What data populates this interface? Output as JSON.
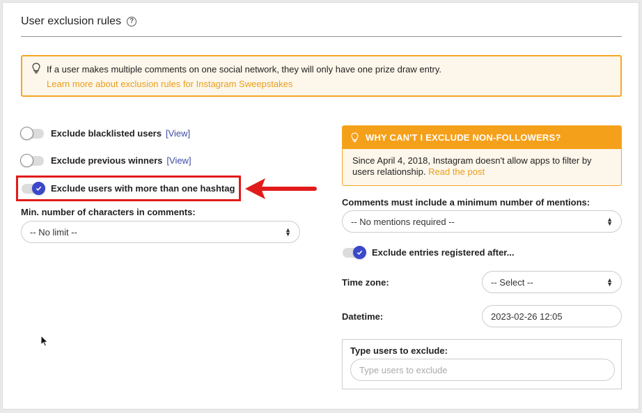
{
  "section": {
    "title": "User exclusion rules",
    "help_icon": "?"
  },
  "notice": {
    "icon": "lightbulb-icon",
    "text": "If a user makes multiple comments on one social network, they will only have one prize draw entry.",
    "link": "Learn more about exclusion rules for Instagram Sweepstakes"
  },
  "left": {
    "toggles": [
      {
        "label": "Exclude blacklisted users",
        "link": "[View]",
        "on": false
      },
      {
        "label": "Exclude previous winners",
        "link": "[View]",
        "on": false
      },
      {
        "label": "Exclude users with more than one hashtag",
        "on": true
      }
    ],
    "min_chars": {
      "label": "Min. number of characters in comments:",
      "value": "-- No limit --"
    }
  },
  "right": {
    "why_box": {
      "title": "WHY CAN'T I EXCLUDE NON-FOLLOWERS?",
      "body": "Since April 4, 2018, Instagram doesn't allow apps to filter by users relationship.",
      "link": "Read the post"
    },
    "mentions": {
      "label": "Comments must include a minimum number of mentions:",
      "value": "-- No mentions required --"
    },
    "registered_toggle": {
      "label": "Exclude entries registered after...",
      "on": true
    },
    "timezone": {
      "label": "Time zone:",
      "value": "-- Select --"
    },
    "datetime": {
      "label": "Datetime:",
      "value": "2023-02-26 12:05"
    },
    "exclude_users": {
      "label": "Type users to exclude:",
      "placeholder": "Type users to exclude"
    }
  },
  "colors": {
    "accent_orange": "#f5a623",
    "toggle_on": "#3b48c9",
    "annotation_red": "#e11b1b",
    "link_blue": "#3e4aa6"
  }
}
